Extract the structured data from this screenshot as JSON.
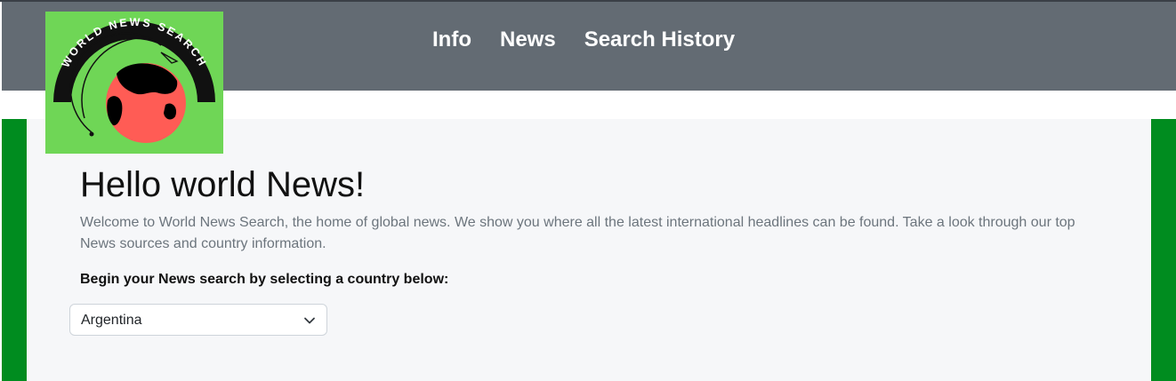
{
  "navbar": {
    "links": [
      {
        "label": "Info"
      },
      {
        "label": "News"
      },
      {
        "label": "Search History"
      }
    ]
  },
  "logo": {
    "text": "WORLD NEWS SEARCH",
    "colors": {
      "background": "#6fd656",
      "globe": "#ff5c55",
      "land": "#000000"
    }
  },
  "main": {
    "title": "Hello world News!",
    "intro": "Welcome to World News Search, the home of global news. We show you where all the latest international headlines can be found. Take a look through our top News sources and country information.",
    "prompt": "Begin your News search by selecting a country below:",
    "country_select": {
      "selected": "Argentina",
      "icon": "chevron-down-icon"
    }
  },
  "colors": {
    "navbar": "#636b73",
    "side_bars": "#008c1f",
    "main_background": "#f6f7f9",
    "muted_text": "#6c757d"
  }
}
